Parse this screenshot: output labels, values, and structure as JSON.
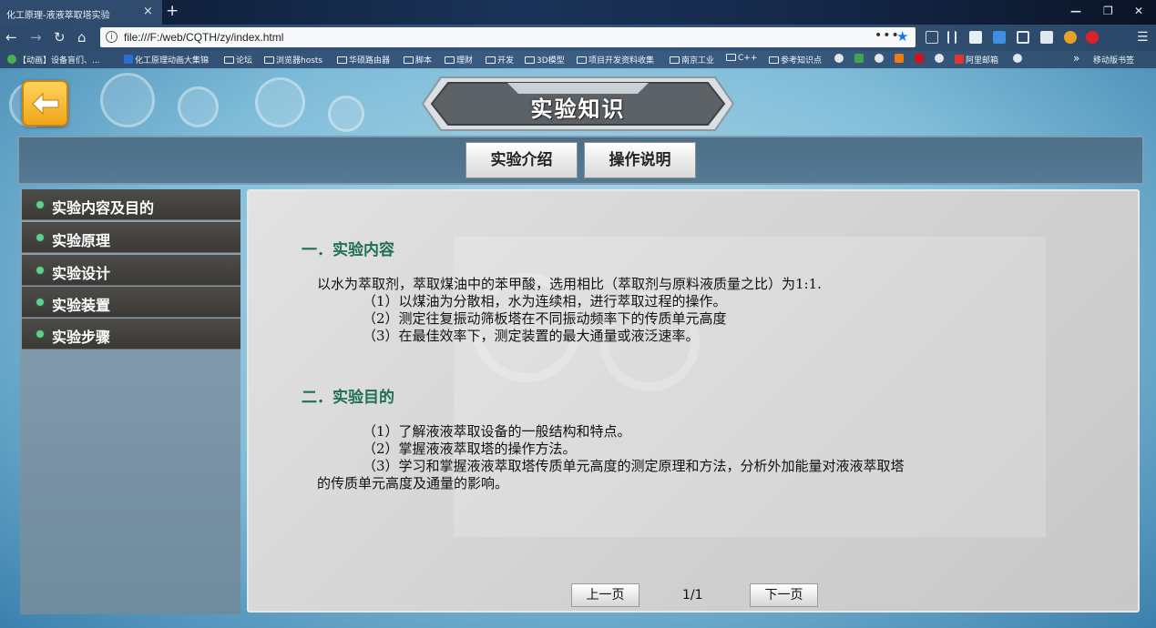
{
  "browser": {
    "tab_title": "化工原理-液液萃取塔实验",
    "tab_close": "×",
    "new_tab": "+",
    "url": "file:///F:/web/CQTH/zy/index.html",
    "url_more": "•••",
    "bookmarks": [
      "【动画】设备盲们、...",
      "化工原理动画大集锦",
      "论坛",
      "浏览器hosts",
      "华硕路由器",
      "脚本",
      "理财",
      "开发",
      "3D模型",
      "项目开发资料收集",
      "南京工业",
      "C++",
      "参考知识点",
      "阿里邮箱"
    ],
    "bookmarks_overflow": "»",
    "mobile_bookmarks": "移动版书签"
  },
  "page": {
    "title": "实验知识",
    "top_buttons": [
      "实验介绍",
      "操作说明"
    ],
    "sidebar": [
      "实验内容及目的",
      "实验原理",
      "实验设计",
      "实验装置",
      "实验步骤"
    ],
    "section1": {
      "heading": "一．实验内容",
      "lines": [
        "以水为萃取剂，萃取煤油中的苯甲酸，选用相比（萃取剂与原料液质量之比）为1:1.",
        "（1）以煤油为分散相，水为连续相，进行萃取过程的操作。",
        "（2）测定往复振动筛板塔在不同振动频率下的传质单元高度",
        "（3）在最佳效率下，测定装置的最大通量或液泛速率。"
      ]
    },
    "section2": {
      "heading": "二．实验目的",
      "lines": [
        "（1）了解液液萃取设备的一般结构和特点。",
        "（2）掌握液液萃取塔的操作方法。",
        "（3）学习和掌握液液萃取塔传质单元高度的测定原理和方法，分析外加能量对液液萃取塔",
        "的传质单元高度及通量的影响。"
      ]
    },
    "pager": {
      "prev": "上一页",
      "page": "1/1",
      "next": "下一页"
    }
  },
  "colors": {
    "section_heading": "#1e6e58",
    "sidebar_item": "#3a3936",
    "back_button": "#f0a51a"
  }
}
